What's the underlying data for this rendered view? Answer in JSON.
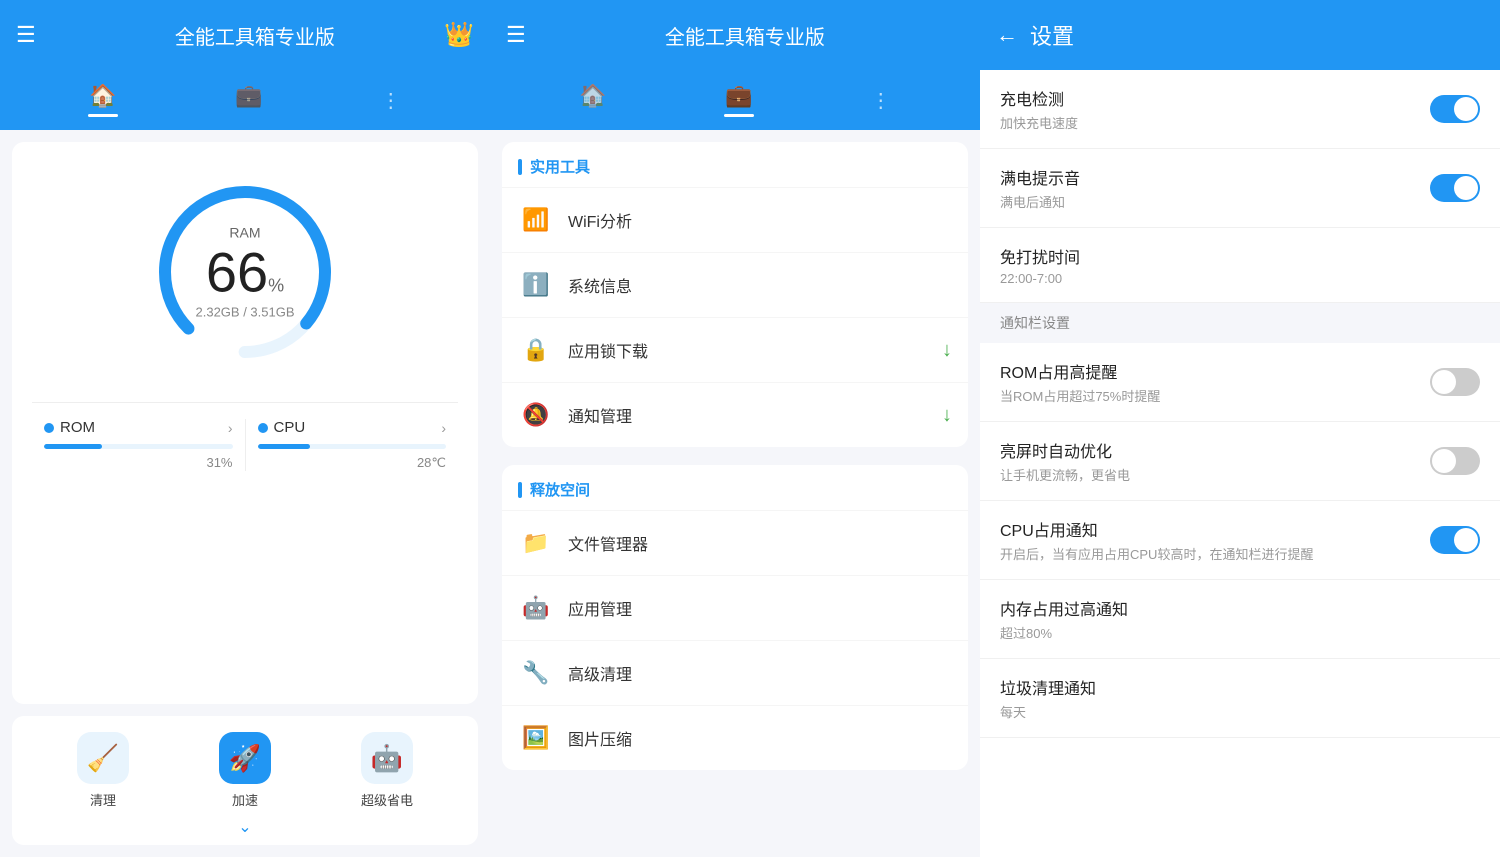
{
  "panel1": {
    "header": {
      "menu_icon": "☰",
      "title": "全能工具箱专业版",
      "crown_icon": "👑"
    },
    "tabs": [
      {
        "icon": "🏠",
        "active": true,
        "name": "home"
      },
      {
        "icon": "💼",
        "active": false,
        "name": "tools"
      },
      {
        "icon": "⋮",
        "active": false,
        "name": "more"
      }
    ],
    "gauge": {
      "label": "RAM",
      "value": "66",
      "percent": "%",
      "sub": "2.32GB / 3.51GB"
    },
    "stats": [
      {
        "name": "ROM",
        "fill_percent": 31,
        "value": "31%",
        "dot_color": "#2196f3"
      },
      {
        "name": "CPU",
        "fill_percent": 28,
        "value": "28℃",
        "dot_color": "#2196f3"
      }
    ],
    "actions": [
      {
        "icon": "🧹",
        "label": "清理",
        "has_chevron": false
      },
      {
        "icon": "🚀",
        "label": "加速",
        "has_chevron": true
      },
      {
        "icon": "🤖",
        "label": "超级省电",
        "has_chevron": false
      }
    ]
  },
  "panel2": {
    "header": {
      "menu_icon": "☰",
      "title": "全能工具箱专业版"
    },
    "tabs": [
      {
        "icon": "🏠",
        "active": false,
        "name": "home"
      },
      {
        "icon": "💼",
        "active": true,
        "name": "tools"
      },
      {
        "icon": "⋮",
        "active": false,
        "name": "more"
      }
    ],
    "sections": [
      {
        "title": "实用工具",
        "items": [
          {
            "icon": "📶",
            "label": "WiFi分析",
            "badge": null
          },
          {
            "icon": "ℹ️",
            "label": "系统信息",
            "badge": null
          },
          {
            "icon": "🔒",
            "label": "应用锁下载",
            "badge": "↓"
          },
          {
            "icon": "🔕",
            "label": "通知管理",
            "badge": "↓"
          }
        ]
      },
      {
        "title": "释放空间",
        "items": [
          {
            "icon": "📁",
            "label": "文件管理器",
            "badge": null
          },
          {
            "icon": "🤖",
            "label": "应用管理",
            "badge": null
          },
          {
            "icon": "🔧",
            "label": "高级清理",
            "badge": null
          },
          {
            "icon": "🖼️",
            "label": "图片压缩",
            "badge": null
          }
        ]
      }
    ]
  },
  "panel3": {
    "header": {
      "back_icon": "←",
      "title": "设置"
    },
    "settings": [
      {
        "id": "charge_detect",
        "title": "充电检测",
        "subtitle": "加快充电速度",
        "toggle": "on",
        "section_header": null
      },
      {
        "id": "full_sound",
        "title": "满电提示音",
        "subtitle": "满电后通知",
        "toggle": "on",
        "section_header": null
      },
      {
        "id": "no_disturb",
        "title": "免打扰时间",
        "subtitle": "22:00-7:00",
        "toggle": null,
        "section_header": null
      },
      {
        "id": "notification_settings",
        "title": "通知栏设置",
        "subtitle": null,
        "toggle": null,
        "section_header": "通知栏设置",
        "is_header": true
      },
      {
        "id": "rom_high",
        "title": "ROM占用高提醒",
        "subtitle": "当ROM占用超过75%时提醒",
        "toggle": "off",
        "section_header": null
      },
      {
        "id": "screen_optimize",
        "title": "亮屏时自动优化",
        "subtitle": "让手机更流畅，更省电",
        "toggle": "off",
        "section_header": null
      },
      {
        "id": "cpu_notify",
        "title": "CPU占用通知",
        "subtitle": "开启后，当有应用占用CPU较高时，在通知栏进行提醒",
        "toggle": "on",
        "section_header": null
      },
      {
        "id": "mem_high",
        "title": "内存占用过高通知",
        "subtitle": "超过80%",
        "toggle": null,
        "section_header": null
      },
      {
        "id": "junk_clean",
        "title": "垃圾清理通知",
        "subtitle": "每天",
        "toggle": null,
        "section_header": null
      }
    ]
  },
  "colors": {
    "primary": "#2196f3",
    "on_toggle": "#2196f3",
    "off_toggle": "#cccccc",
    "section_bg": "#f5f6fa"
  }
}
